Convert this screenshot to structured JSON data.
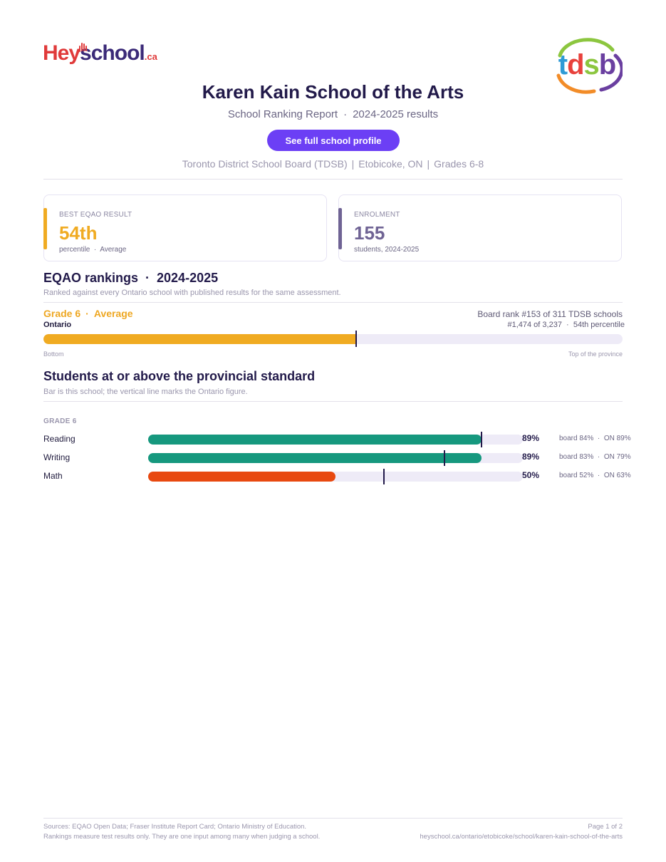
{
  "brand": {
    "heyschool_hey": "Hey",
    "heyschool_school": "school",
    "heyschool_ca": ".ca",
    "board_logo": "tdsb"
  },
  "header": {
    "school_name": "Karen Kain School of the Arts",
    "report_type": "School Ranking Report",
    "results_year": "2024-2025 results",
    "profile_button": "See full school profile",
    "board": "Toronto District School Board (TDSB)",
    "location": "Etobicoke, ON",
    "grades": "Grades 6-8"
  },
  "stats": {
    "best_eqao": {
      "label": "BEST EQAO RESULT",
      "value": "54th",
      "sub": "percentile  ·  Average",
      "color": "#f0ab22"
    },
    "enrolment": {
      "label": "ENROLMENT",
      "value": "155",
      "sub": "students, 2024-2025",
      "color": "#6f6394"
    }
  },
  "rankings": {
    "title": "EQAO rankings  ·  2024-2025",
    "note": "Ranked against every Ontario school with published results for the same assessment.",
    "grade": "Grade 6",
    "level": "Average",
    "scope": "Ontario",
    "board_rank": "Board rank #153 of 311 TDSB schools",
    "province_rank": "#1,474 of 3,237  ·  54th percentile",
    "percentile": 54,
    "axis_low": "Bottom",
    "axis_high": "Top of the province"
  },
  "standards": {
    "title": "Students at or above the provincial standard",
    "note": "Bar is this school; the vertical line marks the Ontario figure.",
    "grade_label": "GRADE 6",
    "rows": [
      {
        "subject": "Reading",
        "school": 89,
        "board": 84,
        "ontario": 89,
        "school_label": "89%",
        "compare": "board 84%  ·  ON 89%",
        "color": "#16987e"
      },
      {
        "subject": "Writing",
        "school": 89,
        "board": 83,
        "ontario": 79,
        "school_label": "89%",
        "compare": "board 83%  ·  ON 79%",
        "color": "#16987e"
      },
      {
        "subject": "Math",
        "school": 50,
        "board": 52,
        "ontario": 63,
        "school_label": "50%",
        "compare": "board 52%  ·  ON 63%",
        "color": "#e84910"
      }
    ]
  },
  "footer": {
    "sources": "Sources: EQAO Open Data; Fraser Institute Report Card; Ontario Ministry of Education.",
    "disclaimer": "Rankings measure test results only. They are one input among many when judging a school.",
    "page": "Page 1 of 2",
    "url": "heyschool.ca/ontario/etobicoke/school/karen-kain-school-of-the-arts"
  }
}
